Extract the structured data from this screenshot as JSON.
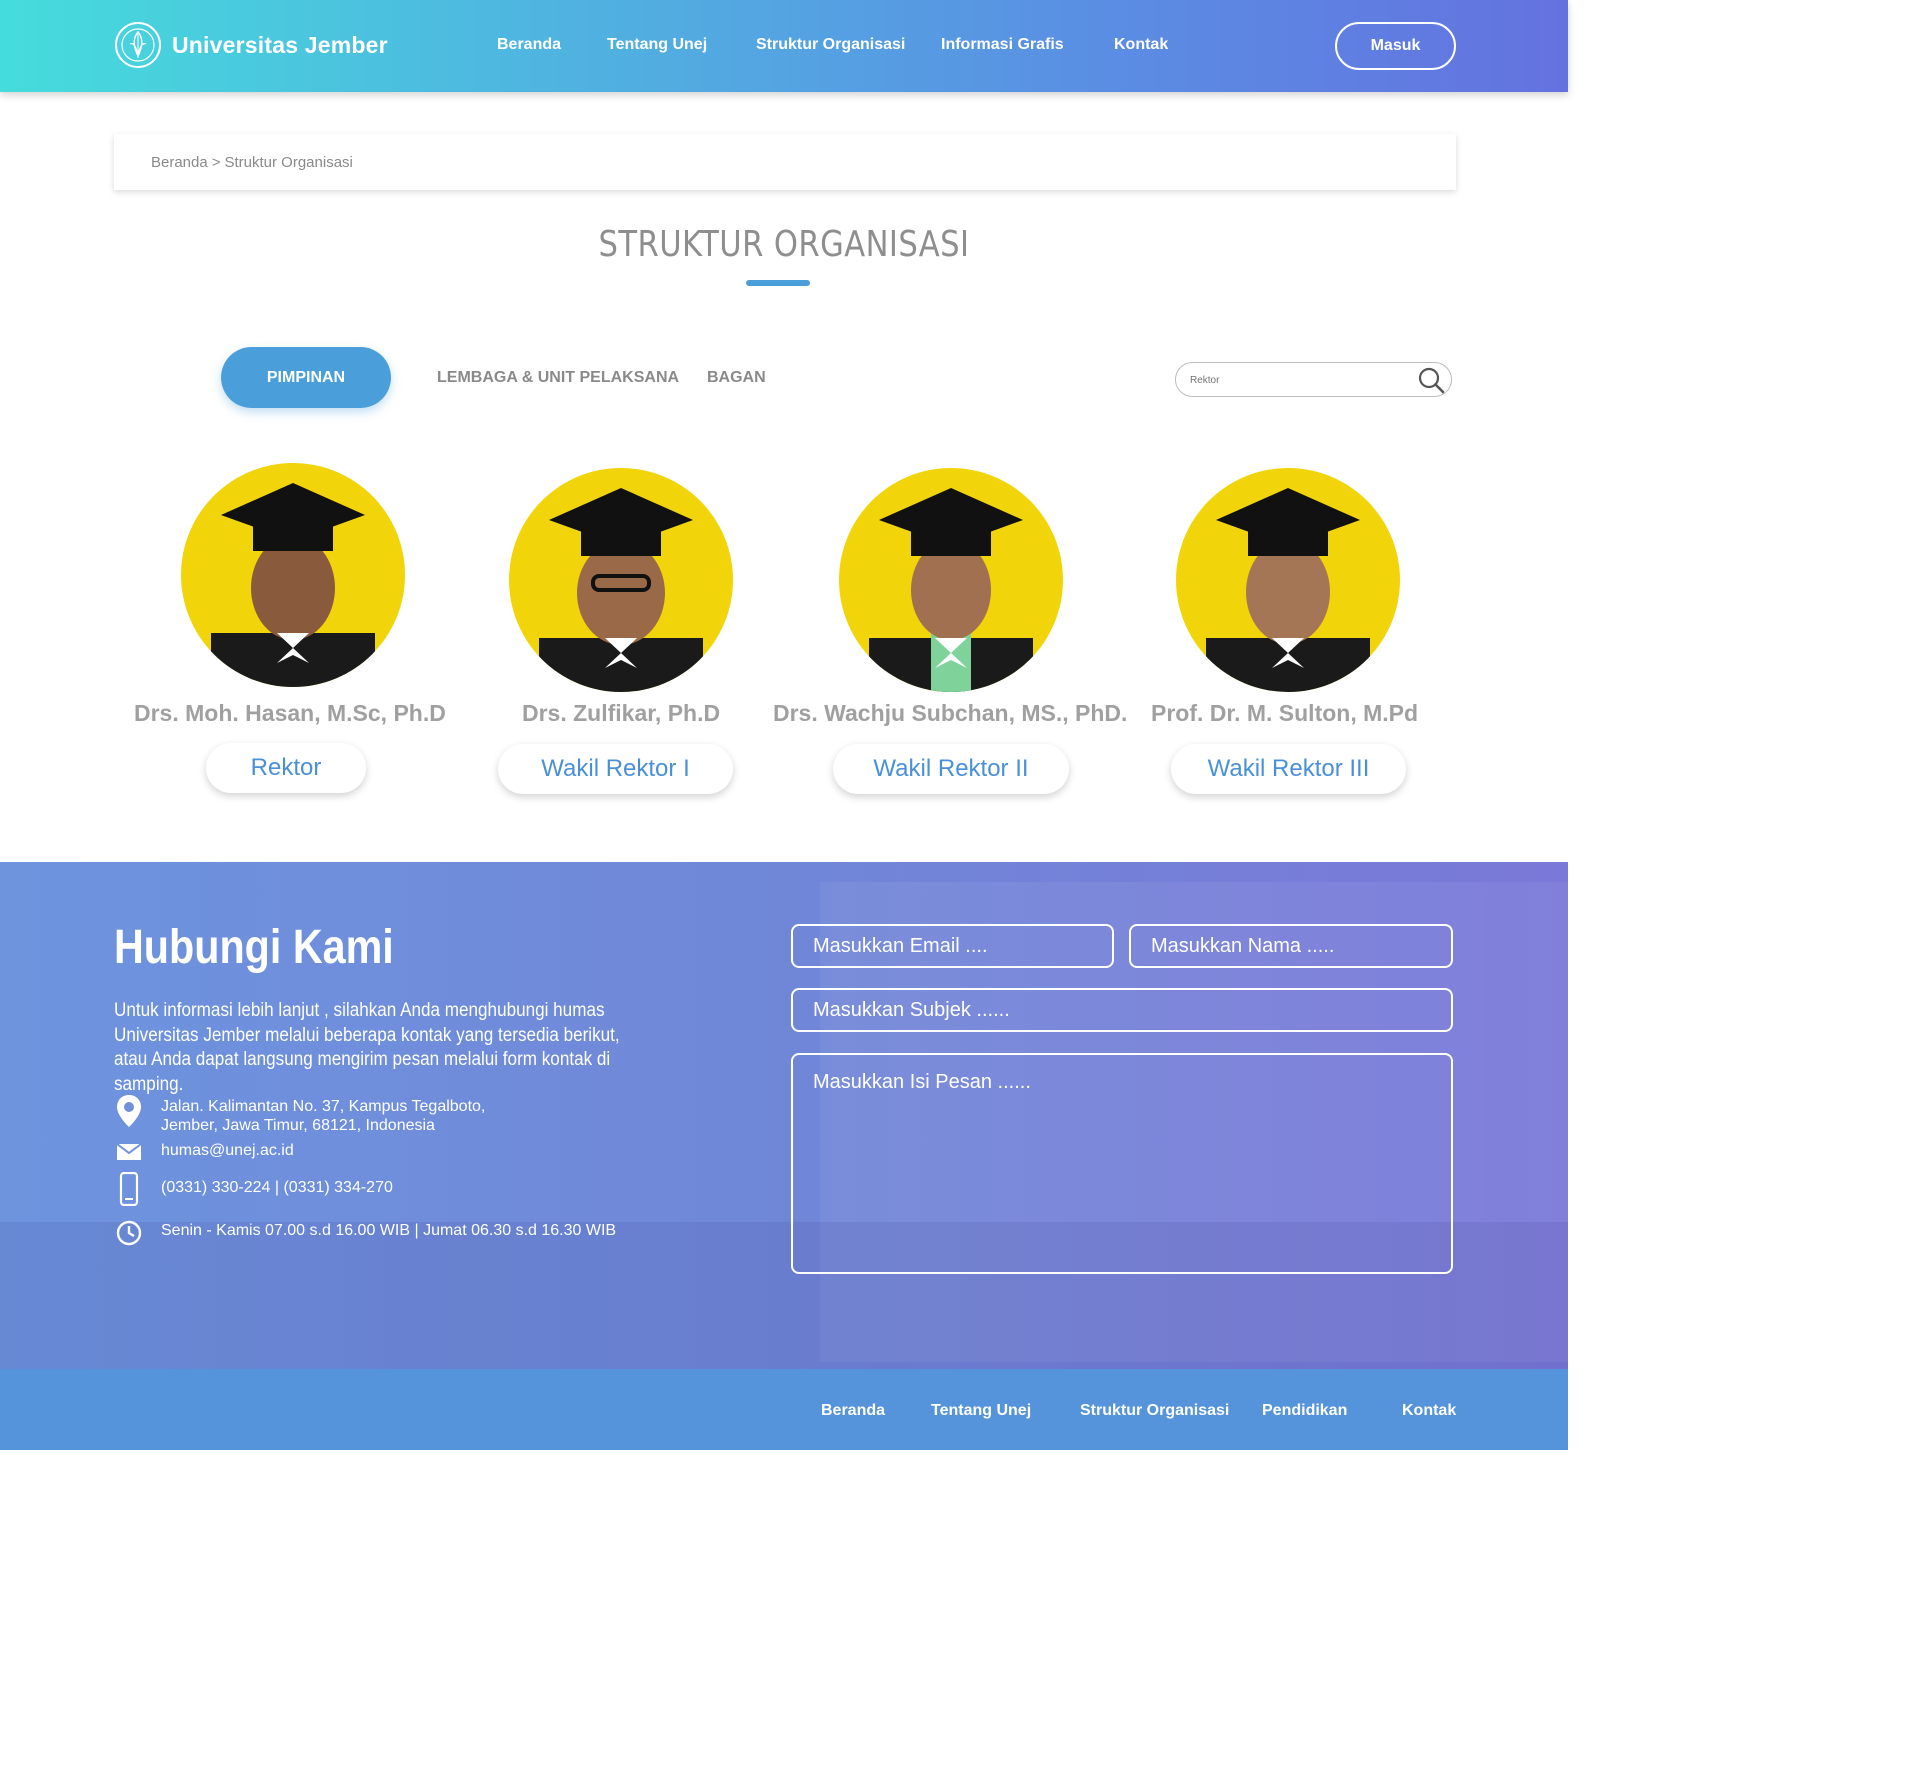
{
  "brand": {
    "name": "Universitas Jember"
  },
  "nav": {
    "items": [
      "Beranda",
      "Tentang Unej",
      "Struktur Organisasi",
      "Informasi Grafis",
      "Kontak"
    ],
    "login_label": "Masuk"
  },
  "breadcrumb": {
    "home": "Beranda",
    "separator": ">",
    "current": "Struktur Organisasi"
  },
  "page": {
    "title": "STRUKTUR ORGANISASI"
  },
  "tabs": {
    "active": "PIMPINAN",
    "items": [
      "LEMBAGA & UNIT PELAKSANA",
      "BAGAN"
    ]
  },
  "search": {
    "placeholder": "Rektor"
  },
  "leaders": [
    {
      "name": "Drs. Moh. Hasan, M.Sc, Ph.D",
      "role": "Rektor"
    },
    {
      "name": "Drs. Zulfikar, Ph.D",
      "role": "Wakil Rektor I"
    },
    {
      "name": "Drs. Wachju Subchan, MS., PhD.",
      "role": "Wakil Rektor II"
    },
    {
      "name": "Prof. Dr. M. Sulton, M.Pd",
      "role": "Wakil Rektor III"
    }
  ],
  "contact": {
    "title": "Hubungi Kami",
    "description": "Untuk informasi lebih lanjut , silahkan Anda menghubungi humas Universitas Jember melalui beberapa kontak yang tersedia berikut, atau Anda dapat langsung mengirim pesan melalui form kontak di samping.",
    "address_line1": "Jalan. Kalimantan No. 37, Kampus Tegalboto,",
    "address_line2": "Jember, Jawa Timur, 68121, Indonesia",
    "email": "humas@unej.ac.id",
    "phone": "(0331) 330-224 | (0331) 334-270",
    "hours": "Senin - Kamis 07.00 s.d 16.00 WIB | Jumat 06.30 s.d 16.30 WIB"
  },
  "form": {
    "email_placeholder": "Masukkan Email ....",
    "name_placeholder": "Masukkan Nama .....",
    "subject_placeholder": "Masukkan Subjek ......",
    "message_placeholder": "Masukkan Isi Pesan ......"
  },
  "footer": {
    "items": [
      "Beranda",
      "Tentang Unej",
      "Struktur Organisasi",
      "Pendidikan",
      "Kontak"
    ]
  },
  "colors": {
    "accent": "#4a9fdb",
    "role_text": "#4a90d9",
    "footer_bg": "#5593db"
  }
}
